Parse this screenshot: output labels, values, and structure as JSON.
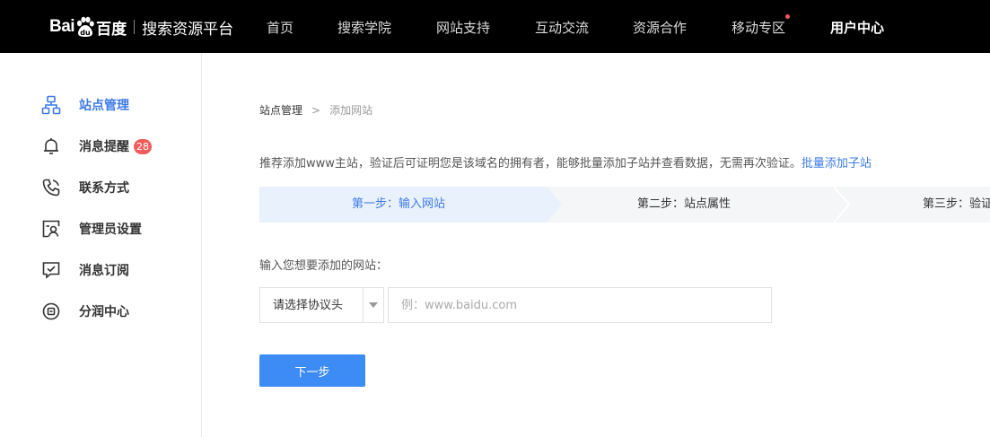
{
  "header": {
    "logo": {
      "brand_latin": "Bai",
      "brand_cn": "百度",
      "platform": "搜索资源平台"
    },
    "nav": [
      {
        "label": "首页"
      },
      {
        "label": "搜索学院"
      },
      {
        "label": "网站支持"
      },
      {
        "label": "互动交流"
      },
      {
        "label": "资源合作"
      },
      {
        "label": "移动专区",
        "has_dot": true
      },
      {
        "label": "用户中心",
        "active": true
      }
    ]
  },
  "sidebar": {
    "items": [
      {
        "label": "站点管理",
        "icon": "sitemap-icon",
        "active": true
      },
      {
        "label": "消息提醒",
        "icon": "bell-icon",
        "badge": "28"
      },
      {
        "label": "联系方式",
        "icon": "phone-icon"
      },
      {
        "label": "管理员设置",
        "icon": "admin-user-icon"
      },
      {
        "label": "消息订阅",
        "icon": "subscribe-icon"
      },
      {
        "label": "分润中心",
        "icon": "revenue-icon"
      }
    ]
  },
  "breadcrumb": {
    "parent": "站点管理",
    "separator": ">",
    "current": "添加网站"
  },
  "intro": {
    "text": "推荐添加www主站，验证后可证明您是该域名的拥有者，能够批量添加子站并查看数据，无需再次验证。",
    "link": "批量添加子站"
  },
  "steps": [
    {
      "label": "第一步：输入网站",
      "active": true
    },
    {
      "label": "第二步：站点属性"
    },
    {
      "label": "第三步：验证网站"
    }
  ],
  "form": {
    "label": "输入您想要添加的网站：",
    "protocol_placeholder": "请选择协议头",
    "url_value": "",
    "url_placeholder": "例：www.baidu.com",
    "next_button": "下一步"
  },
  "colors": {
    "topbar": "#000000",
    "accent": "#3d7ae8",
    "button": "#3d8bf5",
    "step_active_bg": "#e9f1fd",
    "step_bg": "#f5f6f8",
    "badge": "#f25c5c"
  }
}
